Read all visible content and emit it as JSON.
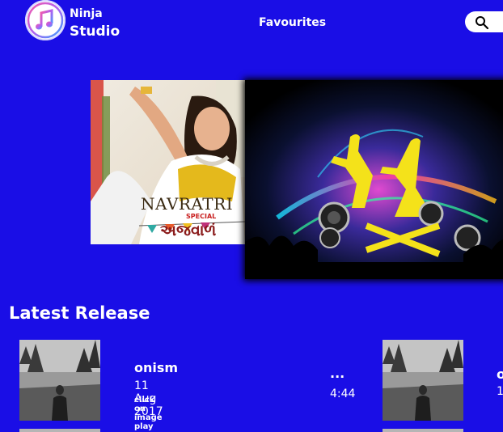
{
  "brand": {
    "line1": "Ninja",
    "line2": "Studio"
  },
  "nav": {
    "favourites": "Favourites"
  },
  "search": {
    "icon": "search-icon"
  },
  "banner": {
    "left": {
      "title": "NAVRATRI",
      "special": "SPECIAL",
      "subtitle": "અજવાળં"
    }
  },
  "latest": {
    "title": "Latest Release",
    "items": [
      {
        "title": "onism",
        "date": "11 Aug 2017",
        "hint": "click on image play",
        "more": "...",
        "duration": "4:44"
      },
      {
        "title": "o",
        "date": "1",
        "hint": "",
        "more": "",
        "duration": ""
      }
    ]
  },
  "colors": {
    "background": "#1a0ee6",
    "text": "#ffffff"
  }
}
